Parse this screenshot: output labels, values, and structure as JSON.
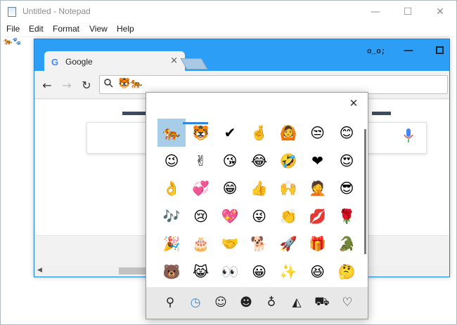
{
  "notepad": {
    "title": "Untitled - Notepad",
    "menus": [
      "File",
      "Edit",
      "Format",
      "View",
      "Help"
    ],
    "content": "🐅🐾",
    "controls": {
      "minimize": "—",
      "maximize": "☐",
      "close": "✕"
    }
  },
  "chrome": {
    "tab_title": "Google",
    "tab_icon": "G",
    "tab_close": "×",
    "profile": "o_o;",
    "omnibox_value": "🐯🐅",
    "nav": {
      "back": "←",
      "forward": "→",
      "reload": "↻"
    }
  },
  "emoji_panel": {
    "close_glyph": "✕",
    "emojis": [
      "🐅",
      "🐯",
      "✔",
      "🤞",
      "🙆",
      "😒",
      "😊",
      "😉",
      "✌",
      "😘",
      "😂",
      "🤣",
      "❤",
      "😍",
      "👌",
      "💞",
      "😁",
      "👍",
      "🙌",
      "🤦",
      "😎",
      "🎶",
      "😢",
      "💖",
      "😜",
      "👏",
      "💋",
      "🌹",
      "🎉",
      "🎂",
      "🤝",
      "🐕",
      "🚀",
      "🎁",
      "🐊",
      "🐻",
      "😹",
      "👀",
      "😀",
      "✨",
      "😆",
      "🤔"
    ],
    "selected_index": 0,
    "tabs": [
      {
        "name": "search",
        "glyph": "⚲"
      },
      {
        "name": "recent",
        "glyph": "◷"
      },
      {
        "name": "smiley",
        "glyph": "☺"
      },
      {
        "name": "people",
        "glyph": "☻"
      },
      {
        "name": "celebration",
        "glyph": "♁"
      },
      {
        "name": "food",
        "glyph": "◭"
      },
      {
        "name": "travel",
        "glyph": "⛟"
      },
      {
        "name": "symbols",
        "glyph": "♡"
      }
    ],
    "active_tab": 1,
    "accent": "#2f87d8"
  }
}
